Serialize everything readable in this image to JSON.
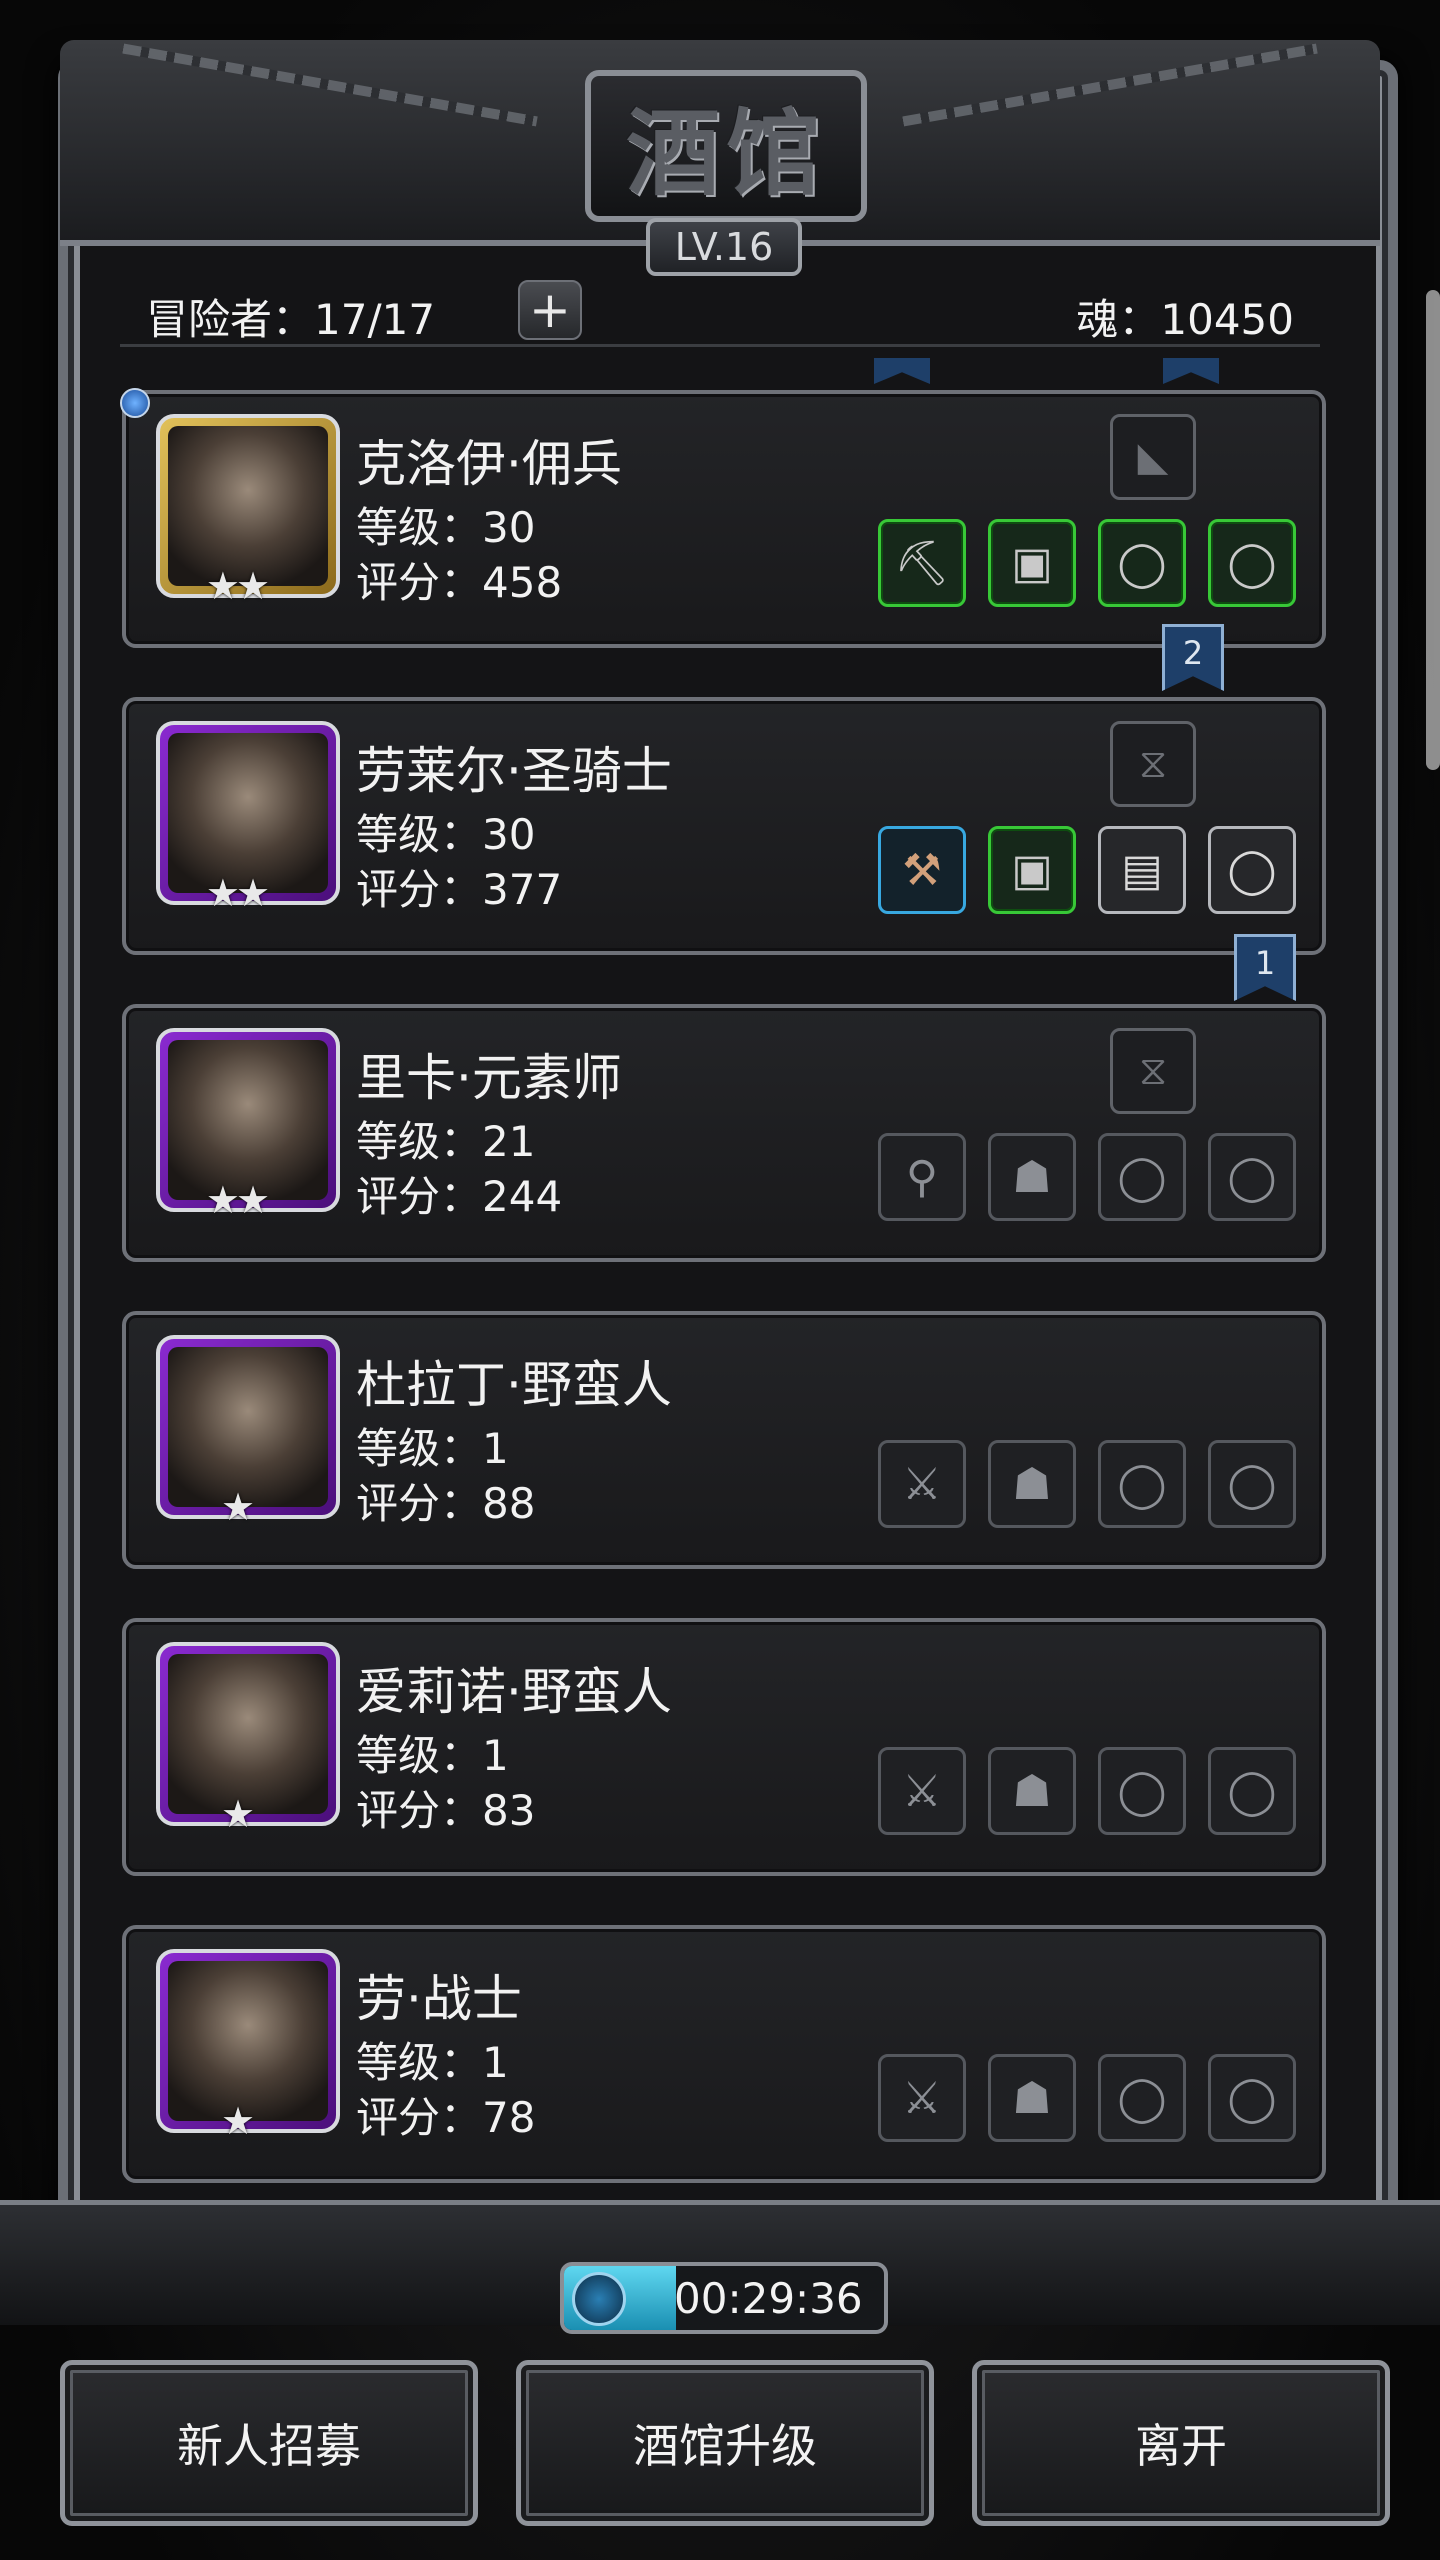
{
  "title": "酒馆",
  "level_badge": "LV.16",
  "stats": {
    "adventurers": "冒险者：17/17",
    "add_symbol": "+",
    "souls": "魂：10450"
  },
  "heroes": [
    {
      "name": "克洛伊·佣兵",
      "level": "等级：30",
      "score": "评分：458",
      "stars": "★★",
      "frame": "gold",
      "top_slot": "◣",
      "slots": [
        {
          "icon": "⛏",
          "style": "green"
        },
        {
          "icon": "▣",
          "style": "green"
        },
        {
          "icon": "◯",
          "style": "green"
        },
        {
          "icon": "◯",
          "style": "green"
        }
      ]
    },
    {
      "name": "劳莱尔·圣骑士",
      "level": "等级：30",
      "score": "评分：377",
      "stars": "★★",
      "frame": "purple",
      "top_slot": "⧖",
      "slots": [
        {
          "icon": "⚒",
          "style": "blue"
        },
        {
          "icon": "▣",
          "style": "green"
        },
        {
          "icon": "▤",
          "style": "white"
        },
        {
          "icon": "◯",
          "style": "white"
        }
      ]
    },
    {
      "name": "里卡·元素师",
      "level": "等级：21",
      "score": "评分：244",
      "stars": "★★",
      "frame": "purple",
      "top_slot": "⧖",
      "slots": [
        {
          "icon": "⚲",
          "style": ""
        },
        {
          "icon": "☗",
          "style": ""
        },
        {
          "icon": "◯",
          "style": ""
        },
        {
          "icon": "◯",
          "style": ""
        }
      ]
    },
    {
      "name": "杜拉丁·野蛮人",
      "level": "等级：1",
      "score": "评分：88",
      "stars": "★",
      "frame": "purple",
      "top_slot": "",
      "slots": [
        {
          "icon": "⚔",
          "style": ""
        },
        {
          "icon": "☗",
          "style": ""
        },
        {
          "icon": "◯",
          "style": ""
        },
        {
          "icon": "◯",
          "style": ""
        }
      ]
    },
    {
      "name": "爱莉诺·野蛮人",
      "level": "等级：1",
      "score": "评分：83",
      "stars": "★",
      "frame": "purple",
      "top_slot": "",
      "slots": [
        {
          "icon": "⚔",
          "style": ""
        },
        {
          "icon": "☗",
          "style": ""
        },
        {
          "icon": "◯",
          "style": ""
        },
        {
          "icon": "◯",
          "style": ""
        }
      ]
    },
    {
      "name": "劳·战士",
      "level": "等级：1",
      "score": "评分：78",
      "stars": "★",
      "frame": "purple",
      "top_slot": "",
      "slots": [
        {
          "icon": "⚔",
          "style": ""
        },
        {
          "icon": "☗",
          "style": ""
        },
        {
          "icon": "◯",
          "style": ""
        },
        {
          "icon": "◯",
          "style": ""
        }
      ]
    }
  ],
  "bookmarks": {
    "first": "2",
    "second": "1"
  },
  "timer": {
    "text": "00:29:36",
    "progress": 0.35
  },
  "buttons": {
    "recruit": "新人招募",
    "upgrade": "酒馆升级",
    "leave": "离开"
  }
}
